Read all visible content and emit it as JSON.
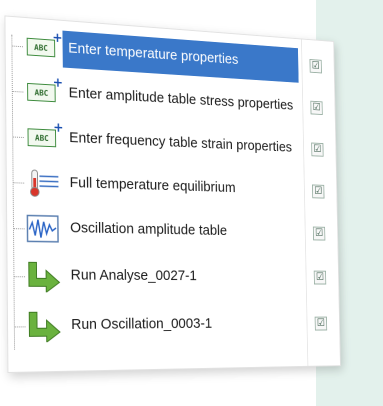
{
  "tree": {
    "items": [
      {
        "label": "Enter temperature properties",
        "icon": "abc-plus-icon",
        "checked": true,
        "selected": true
      },
      {
        "label": "Enter amplitude table stress properties",
        "icon": "abc-plus-icon",
        "checked": true,
        "selected": false
      },
      {
        "label": "Enter frequency table strain properties",
        "icon": "abc-plus-icon",
        "checked": true,
        "selected": false
      },
      {
        "label": "Full temperature equilibrium",
        "icon": "thermometer-icon",
        "checked": true,
        "selected": false
      },
      {
        "label": "Oscillation amplitude table",
        "icon": "waveform-icon",
        "checked": true,
        "selected": false
      },
      {
        "label": "Run Analyse_0027-1",
        "icon": "green-arrow-icon",
        "checked": true,
        "selected": false
      },
      {
        "label": "Run Oscillation_0003-1",
        "icon": "green-arrow-icon",
        "checked": true,
        "selected": false
      }
    ],
    "abc_text": "ABC",
    "check_glyph": "☑",
    "colors": {
      "selection": "#3a78c9",
      "side_panel": "#e3f1ec",
      "abc_green": "#3c8a3c",
      "arrow_green": "#6ab23e"
    }
  }
}
